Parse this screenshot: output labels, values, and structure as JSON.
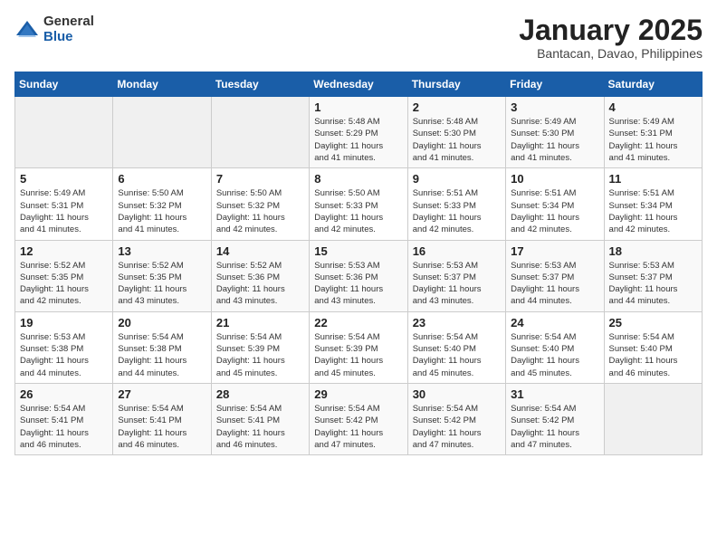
{
  "header": {
    "logo_general": "General",
    "logo_blue": "Blue",
    "month_title": "January 2025",
    "location": "Bantacan, Davao, Philippines"
  },
  "days_of_week": [
    "Sunday",
    "Monday",
    "Tuesday",
    "Wednesday",
    "Thursday",
    "Friday",
    "Saturday"
  ],
  "weeks": [
    [
      {
        "day": "",
        "info": ""
      },
      {
        "day": "",
        "info": ""
      },
      {
        "day": "",
        "info": ""
      },
      {
        "day": "1",
        "info": "Sunrise: 5:48 AM\nSunset: 5:29 PM\nDaylight: 11 hours\nand 41 minutes."
      },
      {
        "day": "2",
        "info": "Sunrise: 5:48 AM\nSunset: 5:30 PM\nDaylight: 11 hours\nand 41 minutes."
      },
      {
        "day": "3",
        "info": "Sunrise: 5:49 AM\nSunset: 5:30 PM\nDaylight: 11 hours\nand 41 minutes."
      },
      {
        "day": "4",
        "info": "Sunrise: 5:49 AM\nSunset: 5:31 PM\nDaylight: 11 hours\nand 41 minutes."
      }
    ],
    [
      {
        "day": "5",
        "info": "Sunrise: 5:49 AM\nSunset: 5:31 PM\nDaylight: 11 hours\nand 41 minutes."
      },
      {
        "day": "6",
        "info": "Sunrise: 5:50 AM\nSunset: 5:32 PM\nDaylight: 11 hours\nand 41 minutes."
      },
      {
        "day": "7",
        "info": "Sunrise: 5:50 AM\nSunset: 5:32 PM\nDaylight: 11 hours\nand 42 minutes."
      },
      {
        "day": "8",
        "info": "Sunrise: 5:50 AM\nSunset: 5:33 PM\nDaylight: 11 hours\nand 42 minutes."
      },
      {
        "day": "9",
        "info": "Sunrise: 5:51 AM\nSunset: 5:33 PM\nDaylight: 11 hours\nand 42 minutes."
      },
      {
        "day": "10",
        "info": "Sunrise: 5:51 AM\nSunset: 5:34 PM\nDaylight: 11 hours\nand 42 minutes."
      },
      {
        "day": "11",
        "info": "Sunrise: 5:51 AM\nSunset: 5:34 PM\nDaylight: 11 hours\nand 42 minutes."
      }
    ],
    [
      {
        "day": "12",
        "info": "Sunrise: 5:52 AM\nSunset: 5:35 PM\nDaylight: 11 hours\nand 42 minutes."
      },
      {
        "day": "13",
        "info": "Sunrise: 5:52 AM\nSunset: 5:35 PM\nDaylight: 11 hours\nand 43 minutes."
      },
      {
        "day": "14",
        "info": "Sunrise: 5:52 AM\nSunset: 5:36 PM\nDaylight: 11 hours\nand 43 minutes."
      },
      {
        "day": "15",
        "info": "Sunrise: 5:53 AM\nSunset: 5:36 PM\nDaylight: 11 hours\nand 43 minutes."
      },
      {
        "day": "16",
        "info": "Sunrise: 5:53 AM\nSunset: 5:37 PM\nDaylight: 11 hours\nand 43 minutes."
      },
      {
        "day": "17",
        "info": "Sunrise: 5:53 AM\nSunset: 5:37 PM\nDaylight: 11 hours\nand 44 minutes."
      },
      {
        "day": "18",
        "info": "Sunrise: 5:53 AM\nSunset: 5:37 PM\nDaylight: 11 hours\nand 44 minutes."
      }
    ],
    [
      {
        "day": "19",
        "info": "Sunrise: 5:53 AM\nSunset: 5:38 PM\nDaylight: 11 hours\nand 44 minutes."
      },
      {
        "day": "20",
        "info": "Sunrise: 5:54 AM\nSunset: 5:38 PM\nDaylight: 11 hours\nand 44 minutes."
      },
      {
        "day": "21",
        "info": "Sunrise: 5:54 AM\nSunset: 5:39 PM\nDaylight: 11 hours\nand 45 minutes."
      },
      {
        "day": "22",
        "info": "Sunrise: 5:54 AM\nSunset: 5:39 PM\nDaylight: 11 hours\nand 45 minutes."
      },
      {
        "day": "23",
        "info": "Sunrise: 5:54 AM\nSunset: 5:40 PM\nDaylight: 11 hours\nand 45 minutes."
      },
      {
        "day": "24",
        "info": "Sunrise: 5:54 AM\nSunset: 5:40 PM\nDaylight: 11 hours\nand 45 minutes."
      },
      {
        "day": "25",
        "info": "Sunrise: 5:54 AM\nSunset: 5:40 PM\nDaylight: 11 hours\nand 46 minutes."
      }
    ],
    [
      {
        "day": "26",
        "info": "Sunrise: 5:54 AM\nSunset: 5:41 PM\nDaylight: 11 hours\nand 46 minutes."
      },
      {
        "day": "27",
        "info": "Sunrise: 5:54 AM\nSunset: 5:41 PM\nDaylight: 11 hours\nand 46 minutes."
      },
      {
        "day": "28",
        "info": "Sunrise: 5:54 AM\nSunset: 5:41 PM\nDaylight: 11 hours\nand 46 minutes."
      },
      {
        "day": "29",
        "info": "Sunrise: 5:54 AM\nSunset: 5:42 PM\nDaylight: 11 hours\nand 47 minutes."
      },
      {
        "day": "30",
        "info": "Sunrise: 5:54 AM\nSunset: 5:42 PM\nDaylight: 11 hours\nand 47 minutes."
      },
      {
        "day": "31",
        "info": "Sunrise: 5:54 AM\nSunset: 5:42 PM\nDaylight: 11 hours\nand 47 minutes."
      },
      {
        "day": "",
        "info": ""
      }
    ]
  ]
}
